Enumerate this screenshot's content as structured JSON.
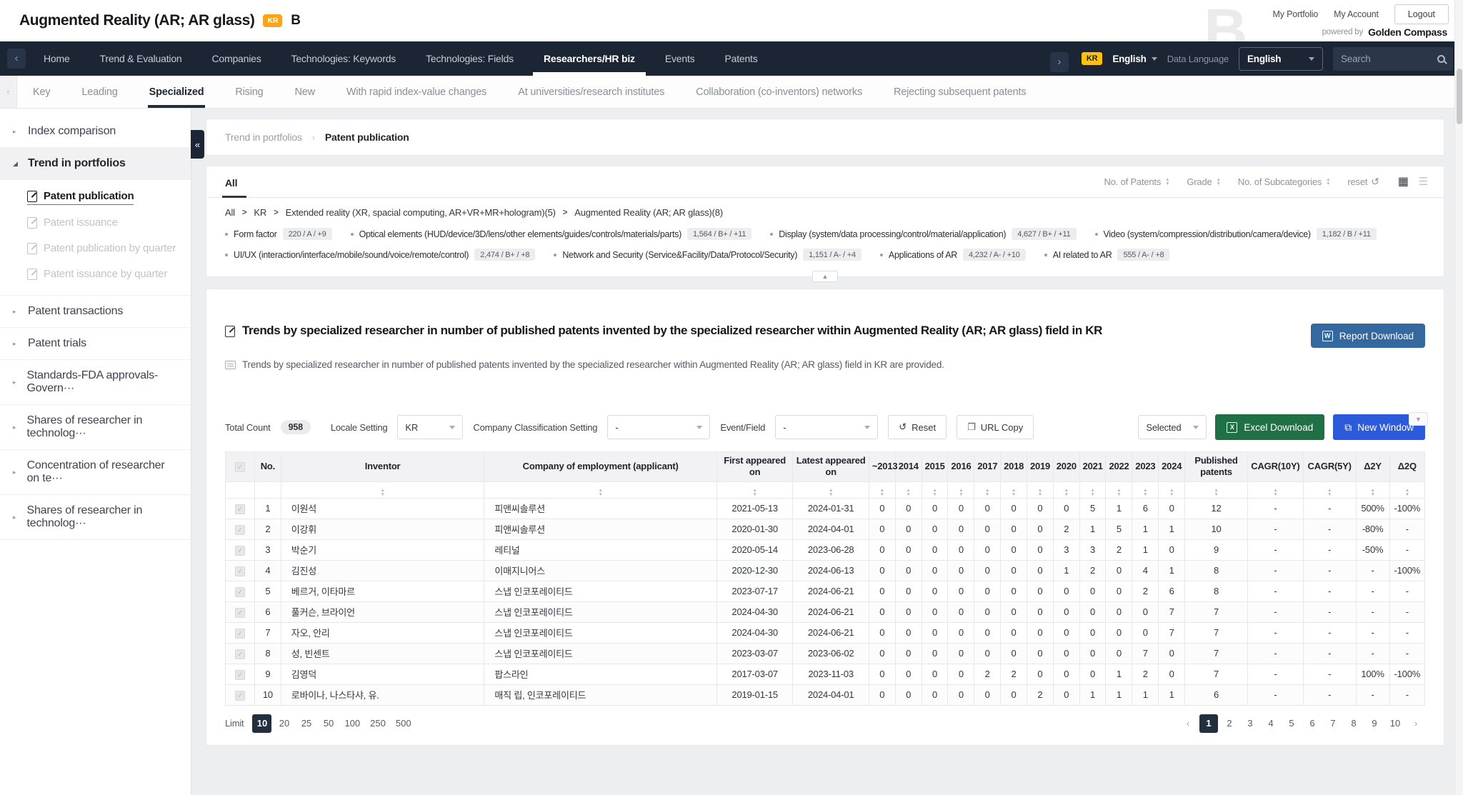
{
  "header": {
    "title": "Augmented Reality (AR; AR glass)",
    "country_badge": "KR",
    "grade_badge": "B",
    "my_portfolio": "My Portfolio",
    "my_account": "My Account",
    "logout": "Logout",
    "powered_by": "powered by",
    "brand": "Golden Compass"
  },
  "nav": {
    "items": [
      {
        "label": "Home",
        "active": false
      },
      {
        "label": "Trend & Evaluation",
        "active": false
      },
      {
        "label": "Companies",
        "active": false
      },
      {
        "label": "Technologies: Keywords",
        "active": false
      },
      {
        "label": "Technologies: Fields",
        "active": false
      },
      {
        "label": "Researchers/HR biz",
        "active": true
      },
      {
        "label": "Events",
        "active": false
      },
      {
        "label": "Patents",
        "active": false
      }
    ],
    "country_badge": "KR",
    "ui_language": "English",
    "data_language_label": "Data Language",
    "data_language_value": "English",
    "search_placeholder": "Search"
  },
  "subtabs": [
    {
      "label": "Key",
      "active": false
    },
    {
      "label": "Leading",
      "active": false
    },
    {
      "label": "Specialized",
      "active": true
    },
    {
      "label": "Rising",
      "active": false
    },
    {
      "label": "New",
      "active": false
    },
    {
      "label": "With rapid index-value changes",
      "active": false
    },
    {
      "label": "At universities/research institutes",
      "active": false
    },
    {
      "label": "Collaboration (co-inventors) networks",
      "active": false
    },
    {
      "label": "Rejecting subsequent patents",
      "active": false
    }
  ],
  "sidebar": {
    "collapse_icon": "«",
    "items": [
      {
        "label": "Index comparison",
        "expanded": false
      },
      {
        "label": "Trend in portfolios",
        "expanded": true,
        "children": [
          {
            "label": "Patent publication",
            "active": true
          },
          {
            "label": "Patent issuance",
            "active": false
          },
          {
            "label": "Patent publication by quarter",
            "active": false
          },
          {
            "label": "Patent issuance by quarter",
            "active": false
          }
        ]
      },
      {
        "label": "Patent transactions",
        "expanded": false
      },
      {
        "label": "Patent trials",
        "expanded": false
      },
      {
        "label": "Standards-FDA approvals-Govern···",
        "expanded": false
      },
      {
        "label": "Shares of researcher in technolog···",
        "expanded": false
      },
      {
        "label": "Concentration of researcher on te···",
        "expanded": false
      },
      {
        "label": "Shares of researcher in technolog···",
        "expanded": false
      }
    ]
  },
  "breadcrumb": {
    "parent": "Trend in portfolios",
    "current": "Patent publication"
  },
  "filter_card": {
    "tab": "All",
    "sort_controls": [
      "No. of Patents",
      "Grade",
      "No. of Subcategories"
    ],
    "reset_label": "reset",
    "path": [
      "All",
      "KR",
      "Extended reality (XR, spacial computing, AR+VR+MR+hologram)(5)",
      "Augmented Reality (AR; AR glass)(8)"
    ],
    "chips": [
      {
        "label": "Form factor",
        "stat": "220 / A / +9"
      },
      {
        "label": "Optical elements (HUD/device/3D/lens/other elements/guides/controls/materials/parts)",
        "stat": "1,564 / B+ / +11"
      },
      {
        "label": "Display (system/data processing/control/material/application)",
        "stat": "4,627 / B+ / +11"
      },
      {
        "label": "Video (system/compression/distribution/camera/device)",
        "stat": "1,182 / B / +11"
      },
      {
        "label": "UI/UX (interaction/interface/mobile/sound/voice/remote/control)",
        "stat": "2,474 / B+ / +8"
      },
      {
        "label": "Network and Security (Service&Facility/Data/Protocol/Security)",
        "stat": "1,151 / A- / +4"
      },
      {
        "label": "Applications of AR",
        "stat": "4,232 / A- / +10"
      },
      {
        "label": "AI related to AR",
        "stat": "555 / A- / +8"
      }
    ]
  },
  "content": {
    "title": "Trends by specialized researcher in number of published patents invented by the specialized researcher within Augmented Reality (AR; AR glass) field in KR",
    "description": "Trends by specialized researcher in number of published patents invented by the specialized researcher within Augmented Reality (AR; AR glass) field in KR are provided.",
    "report_button": "Report Download",
    "controls": {
      "total_count_label": "Total Count",
      "total_count": "958",
      "locale_label": "Locale Setting",
      "locale_value": "KR",
      "company_class_label": "Company Classification Setting",
      "company_class_value": "-",
      "event_field_label": "Event/Field",
      "event_field_value": "-",
      "reset_button": "Reset",
      "url_copy_button": "URL Copy",
      "selected_dropdown": "Selected",
      "excel_button": "Excel Download",
      "new_window_button": "New Window"
    }
  },
  "table": {
    "columns": [
      "No.",
      "Inventor",
      "Company of employment (applicant)",
      "First appeared on",
      "Latest appeared on",
      "~2013",
      "2014",
      "2015",
      "2016",
      "2017",
      "2018",
      "2019",
      "2020",
      "2021",
      "2022",
      "2023",
      "2024",
      "Published patents",
      "CAGR(10Y)",
      "CAGR(5Y)",
      "Δ2Y",
      "Δ2Q"
    ],
    "rows": [
      {
        "no": "1",
        "inventor": "이원석",
        "company": "피앤씨솔루션",
        "first": "2021-05-13",
        "latest": "2024-01-31",
        "years": [
          "0",
          "0",
          "0",
          "0",
          "0",
          "0",
          "0",
          "0",
          "5",
          "1",
          "6",
          "0"
        ],
        "published": "12",
        "cagr10": "-",
        "cagr5": "-",
        "d2y": "500%",
        "d2q": "-100%"
      },
      {
        "no": "2",
        "inventor": "이강휘",
        "company": "피앤씨솔루션",
        "first": "2020-01-30",
        "latest": "2024-04-01",
        "years": [
          "0",
          "0",
          "0",
          "0",
          "0",
          "0",
          "0",
          "2",
          "1",
          "5",
          "1",
          "1"
        ],
        "published": "10",
        "cagr10": "-",
        "cagr5": "-",
        "d2y": "-80%",
        "d2q": "-"
      },
      {
        "no": "3",
        "inventor": "박순기",
        "company": "레티널",
        "first": "2020-05-14",
        "latest": "2023-06-28",
        "years": [
          "0",
          "0",
          "0",
          "0",
          "0",
          "0",
          "0",
          "3",
          "3",
          "2",
          "1",
          "0"
        ],
        "published": "9",
        "cagr10": "-",
        "cagr5": "-",
        "d2y": "-50%",
        "d2q": "-"
      },
      {
        "no": "4",
        "inventor": "김진성",
        "company": "이매지니어스",
        "first": "2020-12-30",
        "latest": "2024-06-13",
        "years": [
          "0",
          "0",
          "0",
          "0",
          "0",
          "0",
          "0",
          "1",
          "2",
          "0",
          "4",
          "1"
        ],
        "published": "8",
        "cagr10": "-",
        "cagr5": "-",
        "d2y": "-",
        "d2q": "-100%"
      },
      {
        "no": "5",
        "inventor": "베르거, 이타마르",
        "company": "스냅 인코포레이티드",
        "first": "2023-07-17",
        "latest": "2024-06-21",
        "years": [
          "0",
          "0",
          "0",
          "0",
          "0",
          "0",
          "0",
          "0",
          "0",
          "0",
          "2",
          "6"
        ],
        "published": "8",
        "cagr10": "-",
        "cagr5": "-",
        "d2y": "-",
        "d2q": "-"
      },
      {
        "no": "6",
        "inventor": "풀커슨, 브라이언",
        "company": "스냅 인코포레이티드",
        "first": "2024-04-30",
        "latest": "2024-06-21",
        "years": [
          "0",
          "0",
          "0",
          "0",
          "0",
          "0",
          "0",
          "0",
          "0",
          "0",
          "0",
          "7"
        ],
        "published": "7",
        "cagr10": "-",
        "cagr5": "-",
        "d2y": "-",
        "d2q": "-"
      },
      {
        "no": "7",
        "inventor": "자오, 안리",
        "company": "스냅 인코포레이티드",
        "first": "2024-04-30",
        "latest": "2024-06-21",
        "years": [
          "0",
          "0",
          "0",
          "0",
          "0",
          "0",
          "0",
          "0",
          "0",
          "0",
          "0",
          "7"
        ],
        "published": "7",
        "cagr10": "-",
        "cagr5": "-",
        "d2y": "-",
        "d2q": "-"
      },
      {
        "no": "8",
        "inventor": "성, 빈센트",
        "company": "스냅 인코포레이티드",
        "first": "2023-03-07",
        "latest": "2023-06-02",
        "years": [
          "0",
          "0",
          "0",
          "0",
          "0",
          "0",
          "0",
          "0",
          "0",
          "0",
          "7",
          "0"
        ],
        "published": "7",
        "cagr10": "-",
        "cagr5": "-",
        "d2y": "-",
        "d2q": "-"
      },
      {
        "no": "9",
        "inventor": "김영덕",
        "company": "팝스라인",
        "first": "2017-03-07",
        "latest": "2023-11-03",
        "years": [
          "0",
          "0",
          "0",
          "0",
          "2",
          "2",
          "0",
          "0",
          "0",
          "1",
          "2",
          "0"
        ],
        "published": "7",
        "cagr10": "-",
        "cagr5": "-",
        "d2y": "100%",
        "d2q": "-100%"
      },
      {
        "no": "10",
        "inventor": "로바이나, 나스타샤, 유.",
        "company": "매직 립, 인코포레이티드",
        "first": "2019-01-15",
        "latest": "2024-04-01",
        "years": [
          "0",
          "0",
          "0",
          "0",
          "0",
          "0",
          "2",
          "0",
          "1",
          "1",
          "1",
          "1"
        ],
        "published": "6",
        "cagr10": "-",
        "cagr5": "-",
        "d2y": "-",
        "d2q": "-"
      }
    ]
  },
  "pagination": {
    "limit_label": "Limit",
    "limits": [
      "10",
      "20",
      "25",
      "50",
      "100",
      "250",
      "500"
    ],
    "active_limit": "10",
    "pages": [
      "1",
      "2",
      "3",
      "4",
      "5",
      "6",
      "7",
      "8",
      "9",
      "10"
    ],
    "active_page": "1"
  }
}
